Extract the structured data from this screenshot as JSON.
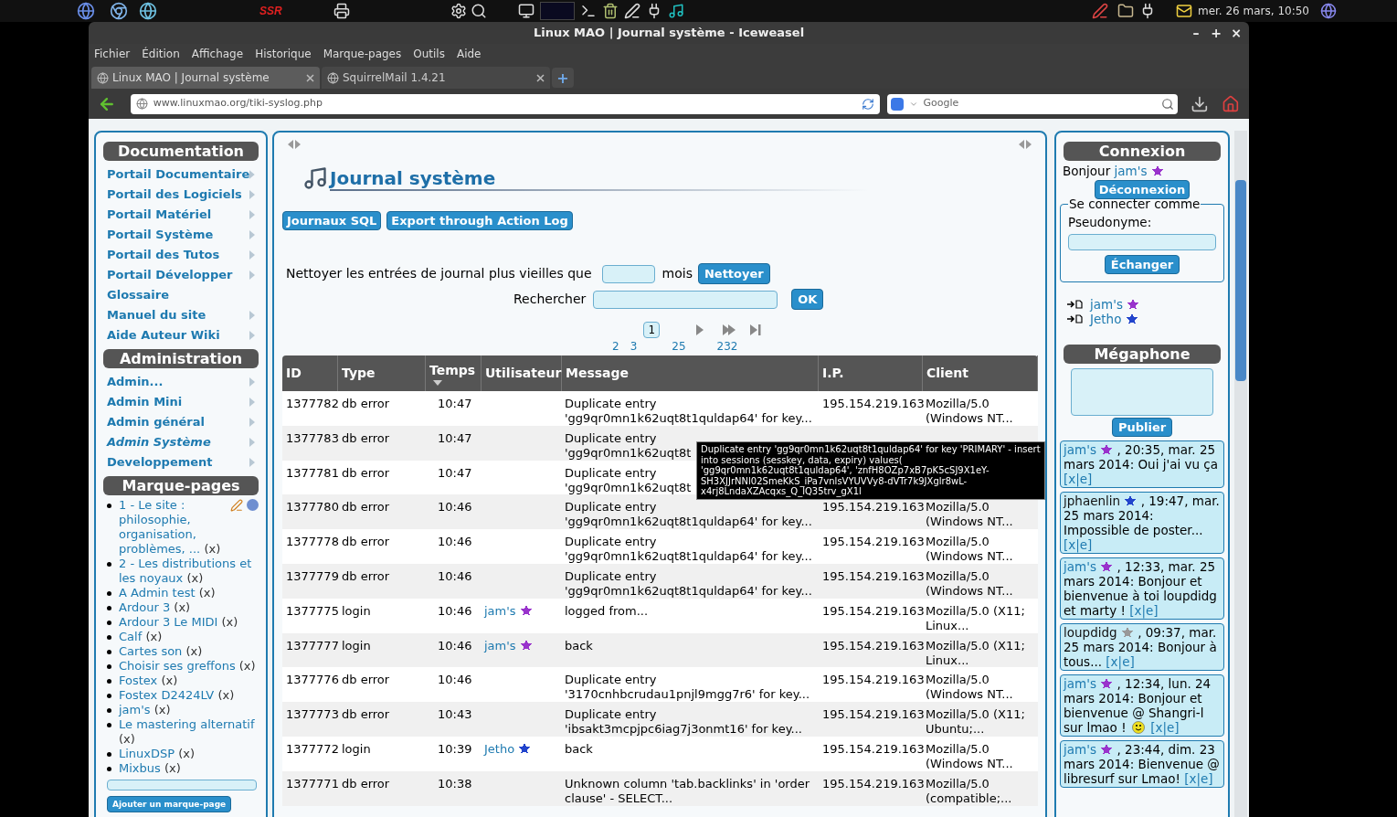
{
  "top_panel": {
    "logo_text": "SSR",
    "clock": "mer. 26 mars, 10:50"
  },
  "window": {
    "title": "Linux MAO | Journal système - Iceweasel",
    "controls": [
      "–",
      "+",
      "×"
    ]
  },
  "menu": [
    "Fichier",
    "Édition",
    "Affichage",
    "Historique",
    "Marque-pages",
    "Outils",
    "Aide"
  ],
  "tabs": [
    {
      "label": "Linux MAO | Journal système",
      "selected": true
    },
    {
      "label": "SquirrelMail 1.4.21",
      "selected": false
    }
  ],
  "new_tab": "+",
  "address": {
    "value": "www.linuxmao.org/tiki-syslog.php"
  },
  "web_search": {
    "placeholder": "Google"
  },
  "left": {
    "sections": [
      {
        "title": "Documentation",
        "items": [
          {
            "label": "Portail Documentaire",
            "submenu": true,
            "current": false
          },
          {
            "label": "Portail des Logiciels",
            "submenu": true,
            "current": false
          },
          {
            "label": "Portail Matériel",
            "submenu": true,
            "current": false
          },
          {
            "label": "Portail Système",
            "submenu": true,
            "current": false
          },
          {
            "label": "Portail des Tutos",
            "submenu": true,
            "current": false
          },
          {
            "label": "Portail Développer",
            "submenu": true,
            "current": false
          },
          {
            "label": "Glossaire",
            "submenu": false,
            "current": false
          },
          {
            "label": "Manuel du site",
            "submenu": true,
            "current": false
          },
          {
            "label": "Aide Auteur Wiki",
            "submenu": true,
            "current": false
          }
        ]
      },
      {
        "title": "Administration",
        "items": [
          {
            "label": "Admin...",
            "submenu": true,
            "current": false
          },
          {
            "label": "Admin Mini",
            "submenu": true,
            "current": false
          },
          {
            "label": "Admin général",
            "submenu": true,
            "current": false
          },
          {
            "label": "Admin Système",
            "submenu": true,
            "current": true
          },
          {
            "label": "Developpement",
            "submenu": true,
            "current": false
          }
        ]
      }
    ],
    "bookmarks": {
      "title": "Marque-pages",
      "items": [
        {
          "label": "1 - Le site : philosophie, organisation, problèmes, ...",
          "remove": "(x)",
          "tools": true
        },
        {
          "label": "2 - Les distributions et les noyaux",
          "remove": "(x)",
          "tools": false
        },
        {
          "label": "A Admin test",
          "remove": "(x)",
          "tools": false
        },
        {
          "label": "Ardour 3",
          "remove": "(x)",
          "tools": false
        },
        {
          "label": "Ardour 3 Le MIDI",
          "remove": "(x)",
          "tools": false
        },
        {
          "label": "Calf",
          "remove": "(x)",
          "tools": false
        },
        {
          "label": "Cartes son",
          "remove": "(x)",
          "tools": false
        },
        {
          "label": "Choisir ses greffons",
          "remove": "(x)",
          "tools": false
        },
        {
          "label": "Fostex",
          "remove": "(x)",
          "tools": false
        },
        {
          "label": "Fostex D2424LV",
          "remove": "(x)",
          "tools": false
        },
        {
          "label": "jam's",
          "remove": "(x)",
          "tools": false
        },
        {
          "label": "Le mastering alternatif",
          "remove": "(x)",
          "tools": false
        },
        {
          "label": "LinuxDSP",
          "remove": "(x)",
          "tools": false
        },
        {
          "label": "Mixbus",
          "remove": "(x)",
          "tools": false
        }
      ],
      "add_button": "Ajouter un marque-page"
    }
  },
  "main": {
    "title": "Journal système",
    "buttons": [
      "Journaux SQL",
      "Export through Action Log"
    ],
    "purge": {
      "label": "Nettoyer les entrées de journal plus vieilles que",
      "unit": "mois",
      "button": "Nettoyer"
    },
    "search": {
      "label": "Rechercher",
      "button": "OK"
    },
    "pagination": {
      "current": "1",
      "pages": [
        "2",
        "3",
        "25",
        "232"
      ]
    },
    "table": {
      "columns": [
        "ID",
        "Type",
        "Temps",
        "Utilisateur",
        "Message",
        "I.P.",
        "Client"
      ],
      "rows": [
        {
          "id": "1377782",
          "type": "db error",
          "time": "10:47",
          "message": [
            "Duplicate entry",
            "'gg9qr0mn1k62uqt8t1quldap64' for key..."
          ],
          "ip": "195.154.219.163",
          "client": [
            "Mozilla/5.0",
            "(Windows NT..."
          ]
        },
        {
          "id": "1377783",
          "type": "db error",
          "time": "10:47",
          "message": [
            "Duplicate entry",
            "'gg9qr0mn1k62uqt8t"
          ]
        },
        {
          "id": "1377781",
          "type": "db error",
          "time": "10:47",
          "message": [
            "Duplicate entry",
            "'gg9qr0mn1k62uqt8t"
          ]
        },
        {
          "id": "1377780",
          "type": "db error",
          "time": "10:46",
          "message": [
            "Duplicate entry",
            "'gg9qr0mn1k62uqt8t1quldap64' for key..."
          ],
          "ip": "195.154.219.163",
          "client": [
            "Mozilla/5.0",
            "(Windows NT..."
          ]
        },
        {
          "id": "1377778",
          "type": "db error",
          "time": "10:46",
          "message": [
            "Duplicate entry",
            "'gg9qr0mn1k62uqt8t1quldap64' for key..."
          ],
          "ip": "195.154.219.163",
          "client": [
            "Mozilla/5.0",
            "(Windows NT..."
          ]
        },
        {
          "id": "1377779",
          "type": "db error",
          "time": "10:46",
          "message": [
            "Duplicate entry",
            "'gg9qr0mn1k62uqt8t1quldap64' for key..."
          ],
          "ip": "195.154.219.163",
          "client": [
            "Mozilla/5.0",
            "(Windows NT..."
          ]
        },
        {
          "id": "1377775",
          "type": "login",
          "time": "10:46",
          "user": {
            "name": "jam's",
            "color": "#9933cc"
          },
          "message": [
            "logged from..."
          ],
          "ip": "195.154.219.163",
          "client": [
            "Mozilla/5.0 (X11;",
            "Linux..."
          ]
        },
        {
          "id": "1377777",
          "type": "login",
          "time": "10:46",
          "user": {
            "name": "jam's",
            "color": "#9933cc"
          },
          "message": [
            "back"
          ],
          "ip": "195.154.219.163",
          "client": [
            "Mozilla/5.0 (X11;",
            "Linux..."
          ]
        },
        {
          "id": "1377776",
          "type": "db error",
          "time": "10:46",
          "message": [
            "Duplicate entry",
            "'3170cnhbcrudau1pnjl9mgg7r6' for key..."
          ],
          "ip": "195.154.219.163",
          "client": [
            "Mozilla/5.0",
            "(Windows NT..."
          ]
        },
        {
          "id": "1377773",
          "type": "db error",
          "time": "10:43",
          "message": [
            "Duplicate entry",
            "'ibsakt3mcpjpc6iag7j3onmt16' for key..."
          ],
          "ip": "195.154.219.163",
          "client": [
            "Mozilla/5.0 (X11;",
            "Ubuntu;..."
          ]
        },
        {
          "id": "1377772",
          "type": "login",
          "time": "10:39",
          "user": {
            "name": "Jetho",
            "color": "#2244cc"
          },
          "message": [
            "back"
          ],
          "ip": "195.154.219.163",
          "client": [
            "Mozilla/5.0",
            "(Windows NT..."
          ]
        },
        {
          "id": "1377771",
          "type": "db error",
          "time": "10:38",
          "message": [
            "Unknown column 'tab.backlinks' in 'order",
            "clause' - SELECT..."
          ],
          "ip": "195.154.219.163",
          "client": [
            "Mozilla/5.0",
            "(compatible;..."
          ]
        }
      ]
    },
    "tooltip": [
      "Duplicate entry 'gg9qr0mn1k62uqt8t1quldap64' for key 'PRIMARY' - insert",
      "into sessions (sesskey, data, expiry) values(",
      "'gg9qr0mn1k62uqt8t1quldap64', 'znfH8OZp7xB7pK5cSJ9X1eY-",
      "SH3XJJrNNl02SmeKkS_iPa7vnlsVYUVVy8-dVTr7k9JXglr8wL-",
      "x4rj8LndaXZAcqxs_Q_lQ35trv_gX1l"
    ]
  },
  "right": {
    "login": {
      "title": "Connexion",
      "greeting": "Bonjour",
      "user": {
        "name": "jam's",
        "color": "#9933cc"
      },
      "logout": "Déconnexion",
      "legend": "Se connecter comme",
      "field_label": "Pseudonyme:",
      "switch": "Échanger"
    },
    "online": [
      {
        "name": "jam's",
        "color": "#9933cc"
      },
      {
        "name": "Jetho",
        "color": "#2244cc"
      }
    ],
    "megaphone": {
      "title": "Mégaphone",
      "button": "Publier",
      "messages": [
        {
          "user": "jam's",
          "linked": true,
          "color": "#9933cc",
          "text": ", 20:35, mar. 25 mars 2014: Oui j'ai vu ça",
          "smiley": false,
          "actions": "[x|e]"
        },
        {
          "user": "jphaenlin",
          "linked": false,
          "color": "#2244cc",
          "text": ", 19:47, mar. 25 mars 2014: Impossible de poster...",
          "smiley": false,
          "actions": "[x|e]"
        },
        {
          "user": "jam's",
          "linked": true,
          "color": "#9933cc",
          "text": ", 12:33, mar. 25 mars 2014: Bonjour et bienvenue à toi loupdidg et marty !",
          "smiley": false,
          "actions": "[x|e]"
        },
        {
          "user": "loupdidg",
          "linked": false,
          "color": "#999999",
          "text": ", 09:37, mar. 25 mars 2014: Bonjour à tous...",
          "smiley": false,
          "actions": "[x|e]"
        },
        {
          "user": "jam's",
          "linked": true,
          "color": "#9933cc",
          "text": ", 12:34, lun. 24 mars 2014: Bonjour et bienvenue @ Shangri-l sur lmao !",
          "smiley": true,
          "actions": "[x|e]"
        },
        {
          "user": "jam's",
          "linked": true,
          "color": "#9933cc",
          "text": ", 23:44, dim. 23 mars 2014: Bienvenue @ libresurf sur Lmao!",
          "smiley": false,
          "actions": "[x|e]"
        }
      ]
    }
  }
}
